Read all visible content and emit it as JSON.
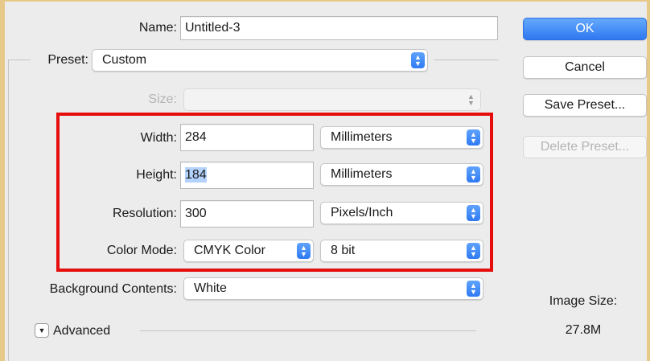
{
  "dialog": {
    "name": {
      "label": "Name:",
      "value": "Untitled-3"
    },
    "preset": {
      "label": "Preset:",
      "value": "Custom"
    },
    "size": {
      "label": "Size:",
      "value": ""
    },
    "width": {
      "label": "Width:",
      "value": "284",
      "unit": "Millimeters"
    },
    "height": {
      "label": "Height:",
      "value": "184",
      "unit": "Millimeters"
    },
    "resolution": {
      "label": "Resolution:",
      "value": "300",
      "unit": "Pixels/Inch"
    },
    "color_mode": {
      "label": "Color Mode:",
      "value": "CMYK Color",
      "depth": "8 bit"
    },
    "background": {
      "label": "Background Contents:",
      "value": "White"
    },
    "advanced": {
      "label": "Advanced"
    }
  },
  "buttons": {
    "ok": "OK",
    "cancel": "Cancel",
    "save_preset": "Save Preset...",
    "delete_preset": "Delete Preset..."
  },
  "image_size": {
    "label": "Image Size:",
    "value": "27.8M"
  },
  "icons": {
    "stepper": "up-down-arrows-icon",
    "disclosure": "triangle-down-icon"
  },
  "colors": {
    "accent": "#2f7af2",
    "highlight_box": "#e60d0d",
    "window_frame": "#e7c98a"
  }
}
